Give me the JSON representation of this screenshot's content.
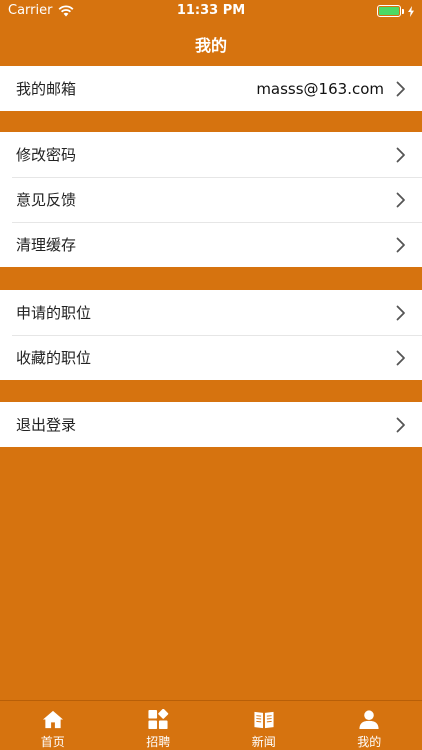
{
  "status_bar": {
    "carrier": "Carrier",
    "time": "11:33 PM"
  },
  "nav": {
    "title": "我的"
  },
  "groups": [
    {
      "rows": [
        {
          "label": "我的邮箱",
          "value": "masss@163.com"
        }
      ]
    },
    {
      "rows": [
        {
          "label": "修改密码"
        },
        {
          "label": "意见反馈"
        },
        {
          "label": "清理缓存"
        }
      ]
    },
    {
      "rows": [
        {
          "label": "申请的职位"
        },
        {
          "label": "收藏的职位"
        }
      ]
    },
    {
      "rows": [
        {
          "label": "退出登录"
        }
      ]
    }
  ],
  "tabs": [
    {
      "label": "首页",
      "icon": "home-icon"
    },
    {
      "label": "招聘",
      "icon": "grid-icon"
    },
    {
      "label": "新闻",
      "icon": "news-icon"
    },
    {
      "label": "我的",
      "icon": "person-icon"
    }
  ],
  "colors": {
    "accent": "#d6730f",
    "battery": "#4cd964"
  }
}
